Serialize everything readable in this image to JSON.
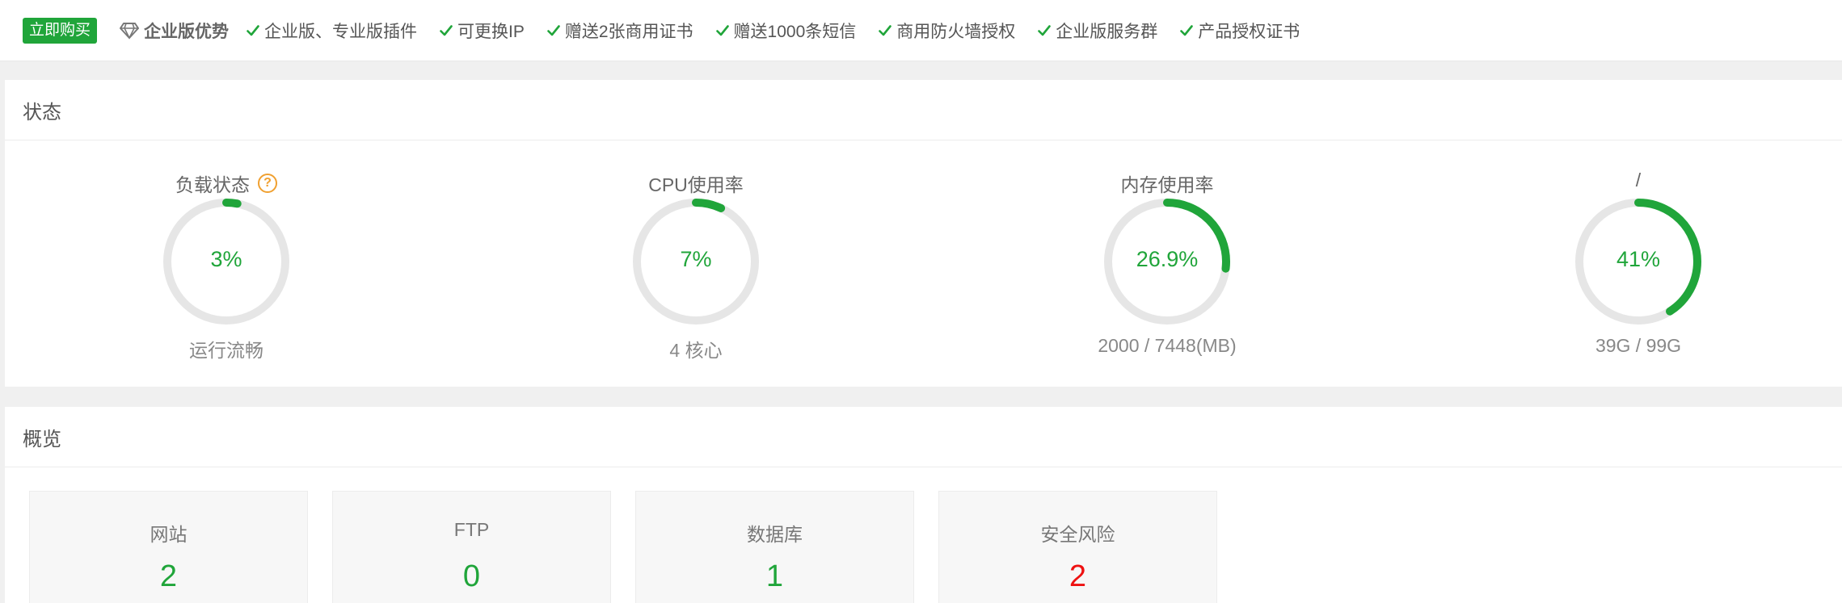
{
  "topbar": {
    "buy_label": "立即购买",
    "enterprise_title": "企业版优势",
    "features": [
      "企业版、专业版插件",
      "可更换IP",
      "赠送2张商用证书",
      "赠送1000条短信",
      "商用防火墙授权",
      "企业版服务群",
      "产品授权证书"
    ]
  },
  "status": {
    "title": "状态",
    "gauges": [
      {
        "title": "负载状态",
        "value_text": "3%",
        "percent": 3,
        "sub": "运行流畅",
        "has_help": true
      },
      {
        "title": "CPU使用率",
        "value_text": "7%",
        "percent": 7,
        "sub": "4 核心",
        "has_help": false
      },
      {
        "title": "内存使用率",
        "value_text": "26.9%",
        "percent": 26.9,
        "sub": "2000 / 7448(MB)",
        "has_help": false
      },
      {
        "title": "/",
        "value_text": "41%",
        "percent": 41,
        "sub": "39G / 99G",
        "has_help": false
      }
    ]
  },
  "overview": {
    "title": "概览",
    "cards": [
      {
        "label": "网站",
        "value": "2",
        "color": "#20a53a"
      },
      {
        "label": "FTP",
        "value": "0",
        "color": "#20a53a"
      },
      {
        "label": "数据库",
        "value": "1",
        "color": "#20a53a"
      },
      {
        "label": "安全风险",
        "value": "2",
        "color": "#ee1111"
      }
    ]
  },
  "colors": {
    "accent": "#20a53a",
    "danger": "#ee1111",
    "help": "#f0a030",
    "track": "#e6e6e6"
  },
  "icons": {
    "enterprise": "diamond-icon",
    "feature": "check-icon",
    "help": "question-icon"
  }
}
